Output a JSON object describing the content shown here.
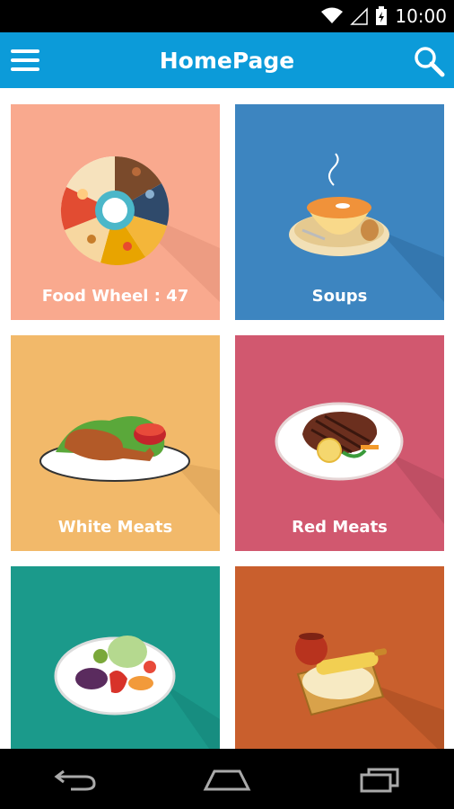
{
  "status_bar": {
    "time": "10:00",
    "icons": [
      "wifi-icon",
      "signal-icon",
      "battery-icon"
    ]
  },
  "app_bar": {
    "title": "HomePage",
    "menu_icon": "hamburger-menu-icon",
    "search_icon": "search-icon",
    "color": "#0C9BD9"
  },
  "tiles": [
    {
      "label": "Food Wheel : 47",
      "color": "#F9A98E",
      "illustration": "food-wheel-icon"
    },
    {
      "label": "Soups",
      "color": "#3D85C0",
      "illustration": "soup-bowl-icon"
    },
    {
      "label": "White Meats",
      "color": "#F2B96A",
      "illustration": "chicken-leg-icon"
    },
    {
      "label": "Red Meats",
      "color": "#D1586F",
      "illustration": "steak-plate-icon"
    },
    {
      "label": "",
      "color": "#1B9A8B",
      "illustration": "vegetables-plate-icon"
    },
    {
      "label": "",
      "color": "#C95F2D",
      "illustration": "rolling-pin-dough-icon"
    }
  ],
  "nav_bar": {
    "icons": [
      "back-icon",
      "home-icon",
      "recents-icon"
    ]
  }
}
